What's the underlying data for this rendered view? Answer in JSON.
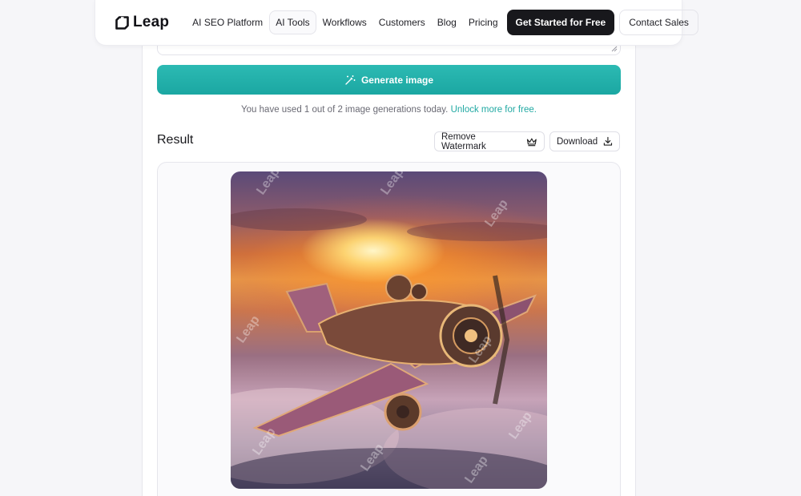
{
  "brand": {
    "name": "Leap"
  },
  "nav": {
    "items": [
      {
        "label": "AI SEO Platform",
        "active": false
      },
      {
        "label": "AI Tools",
        "active": true
      },
      {
        "label": "Workflows",
        "active": false
      },
      {
        "label": "Customers",
        "active": false
      },
      {
        "label": "Blog",
        "active": false
      },
      {
        "label": "Pricing",
        "active": false
      }
    ],
    "cta_label": "Get Started for Free",
    "contact_label": "Contact Sales"
  },
  "generator": {
    "button_label": "Generate image",
    "usage_text": "You have used 1 out of 2 image generations today.",
    "unlock_link": "Unlock more for free."
  },
  "result": {
    "title": "Result",
    "remove_watermark_label": "Remove Watermark",
    "download_label": "Download",
    "watermark_text": "Leap"
  },
  "colors": {
    "accent": "#21a9a3",
    "cta_bg": "#18181c"
  }
}
